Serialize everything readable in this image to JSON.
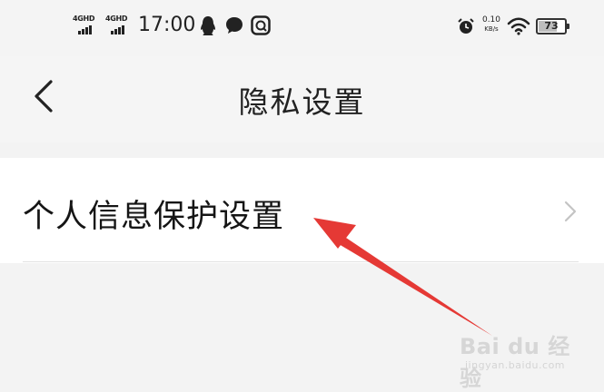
{
  "status_bar": {
    "signal_1": "4GHD",
    "signal_2": "4GHD",
    "time": "17:00",
    "net_speed_value": "0.10",
    "net_speed_unit": "KB/s",
    "battery": "73",
    "battery_level": 0.73,
    "icons": [
      "qq-icon",
      "chat-bubble-icon",
      "baidu-app-icon",
      "alarm-clock-icon",
      "wifi-icon",
      "battery-icon"
    ]
  },
  "nav": {
    "back_icon": "chevron-left-icon",
    "title": "隐私设置"
  },
  "settings": {
    "items": [
      {
        "label": "个人信息保护设置",
        "icon": "chevron-right-icon"
      }
    ]
  },
  "watermark": {
    "main": "Bai du 经验",
    "sub": "jingyan.baidu.com"
  },
  "colors": {
    "background": "#f3f3f3",
    "card": "#ffffff",
    "annotation_arrow": "#e53935"
  }
}
